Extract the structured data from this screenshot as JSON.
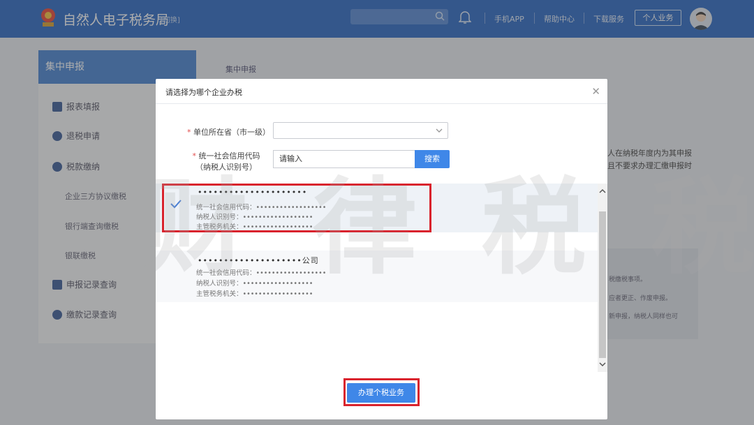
{
  "header": {
    "title": "自然人电子税务局",
    "switch_label": "[切换]",
    "nav": [
      "手机APP",
      "帮助中心",
      "下载服务"
    ],
    "personal_button": "个人业务",
    "brand_color": "#2f6bc4"
  },
  "sidebar": {
    "heading": "集中申报",
    "items": [
      {
        "label": "报表填报",
        "icon": "form-icon"
      },
      {
        "label": "退税申请",
        "icon": "refund-icon"
      },
      {
        "label": "税款缴纳",
        "icon": "payment-icon"
      },
      {
        "label": "企业三方协议缴税"
      },
      {
        "label": "银行端查询缴税"
      },
      {
        "label": "银联缴税"
      },
      {
        "label": "申报记录查询",
        "icon": "record-icon"
      },
      {
        "label": "缴款记录查询",
        "icon": "payment-record-icon"
      }
    ]
  },
  "main": {
    "breadcrumb": "集中申报",
    "bg_lines": [
      "人在纳税年度内为其申报",
      "且不要求办理汇缴申报时"
    ],
    "bg_card_lines": [
      "税缴税事项。",
      "应者更正、作废申报。",
      "新申报，纳税人同样也可"
    ]
  },
  "modal": {
    "title": "请选择为哪个企业办税",
    "province_label": "单位所在省（市一级）",
    "credit_label_1": "统一社会信用代码",
    "credit_label_2": "（纳税人识别号）",
    "credit_placeholder": "请输入",
    "search_button": "搜索",
    "companies": [
      {
        "name": "•••••••••••••••••••••",
        "credit_code": "统一社会信用代码：••••••••••••••••••",
        "taxpayer_id": "纳税人识别号：••••••••••••••••••",
        "tax_authority": "主管税务机关：••••••••••••••••••",
        "selected": true
      },
      {
        "name": "••••••••••••••••••••公司",
        "credit_code": "统一社会信用代码：••••••••••••••••••",
        "taxpayer_id": "纳税人识别号：••••••••••••••••••",
        "tax_authority": "主管税务机关：••••••••••••••••••",
        "selected": false
      }
    ],
    "submit_button": "办理个税业务",
    "accent_color": "#3f87e8",
    "highlight_color": "#d9232d"
  },
  "watermark": "财 律 税 税"
}
